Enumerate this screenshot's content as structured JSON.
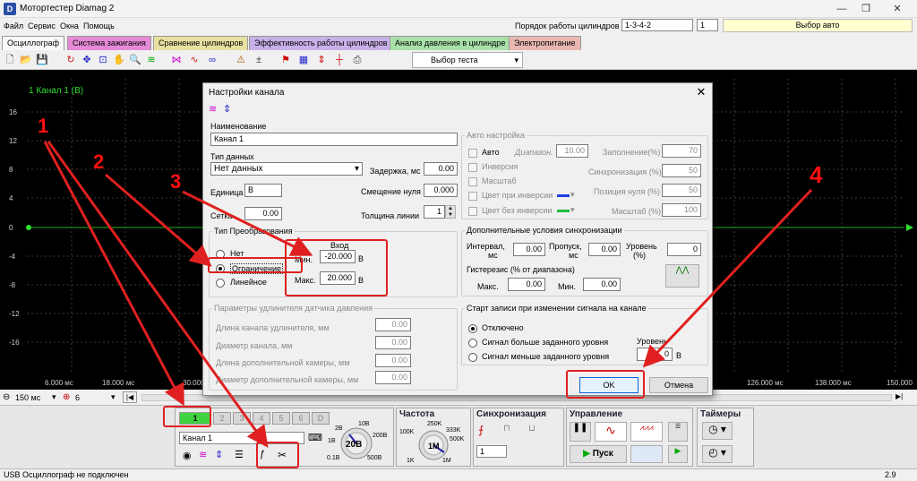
{
  "window": {
    "title": "Мотортестер Diamag 2",
    "icon_text": "D"
  },
  "menu": [
    "Файл",
    "Сервис",
    "Окна",
    "Помощь"
  ],
  "cylinder_order": {
    "label": "Порядок работы цилиндров",
    "value": "1-3-4-2",
    "count": "1",
    "auto_button": "Выбор авто"
  },
  "tabs": [
    {
      "label": "Осциллограф",
      "color": "#f0f0f0"
    },
    {
      "label": "Система зажигания",
      "color": "#e58ad6"
    },
    {
      "label": "Сравнение цилиндров",
      "color": "#e8e0a0"
    },
    {
      "label": "Эффективность работы цилиндров",
      "color": "#c8b0e8"
    },
    {
      "label": "Анализ давления в цилиндре",
      "color": "#a8e0a8"
    },
    {
      "label": "Электропитание",
      "color": "#e8b8b0"
    }
  ],
  "toolbar": {
    "test_select": "Выбор теста"
  },
  "scope": {
    "channel_label": "1 Канал 1 (B)",
    "y_ticks": [
      "16",
      "12",
      "8",
      "4",
      "0",
      "-4",
      "-8",
      "-12",
      "-16"
    ],
    "x_ticks": [
      "6.000 мс",
      "18.000 мс",
      "30.000",
      "126.000 мс",
      "138.000 мс",
      "150.000"
    ],
    "timebase": "150 мс",
    "trigger": "6"
  },
  "dialog": {
    "title": "Настройки канала",
    "name_label": "Наименование",
    "name_value": "Канал 1",
    "data_type_label": "Тип данных",
    "data_type_value": "Нет данных",
    "delay_label": "Задержка, мс",
    "delay_value": "0.00",
    "unit_label": "Единица",
    "unit_value": "В",
    "zero_shift_label": "Смещение нуля",
    "zero_shift_value": "0.000",
    "grid_label": "Сетка",
    "grid_value": "0.00",
    "line_width_label": "Толщина линии",
    "line_width_value": "1",
    "transform": {
      "title": "Тип Преобразования",
      "options": [
        "Нет",
        "Ограничение",
        "Линейное"
      ],
      "selected": "Ограничение",
      "input_header": "Вход",
      "min_label": "Мин.",
      "min_value": "-20.000",
      "max_label": "Макс.",
      "max_value": "20.000",
      "unit": "В"
    },
    "extender": {
      "title": "Параметры удлинителя датчика давления",
      "rows": [
        {
          "label": "Длина канала удлинителя, мм",
          "value": "0.00"
        },
        {
          "label": "Диаметр канала, мм",
          "value": "0.00"
        },
        {
          "label": "Длина дополнительной камеры, мм",
          "value": "0.00"
        },
        {
          "label": "Диаметр дополнительной камеры, мм",
          "value": "0.00"
        }
      ]
    },
    "auto": {
      "title": "Авто настройка",
      "checks": [
        "Авто",
        "Инверсия",
        "Масштаб",
        "Цвет при инверсии",
        "Цвет без инверсии"
      ],
      "range_label": "Диапазон.",
      "range_value": "10.00",
      "fill_label": "Заполнение(%)",
      "fill_value": "70",
      "sync_label": "Синхронизация (%)",
      "sync_value": "50",
      "zero_pos_label": "Позиция нуля (%)",
      "zero_pos_value": "50",
      "scale_label": "Масштаб (%)",
      "scale_value": "100",
      "inv_color": "#2040e0",
      "noinv_color": "#20c040"
    },
    "sync": {
      "title": "Дополнительные условия синхронизации",
      "interval_label": "Интервал,",
      "interval_unit": "мс",
      "interval_value": "0.00",
      "skip_label": "Пропуск,",
      "skip_unit": "мс",
      "skip_value": "0.00",
      "level_label": "Уровень",
      "level_unit": "(%)",
      "level_value": "0",
      "hyst_label": "Гистерезис (% от диапазона)",
      "max_label": "Макс.",
      "max_value": "0.00",
      "min_label": "Мин.",
      "min_value": "0.00"
    },
    "record": {
      "title": "Старт записи при изменении сигнала на канале",
      "options": [
        "Отключено",
        "Сигнал больше заданного уровня",
        "Сигнал меньше заданного уровня"
      ],
      "selected": "Отключено",
      "level_label": "Уровень",
      "level_value": "0",
      "unit": "В"
    },
    "ok": "OK",
    "cancel": "Отмена"
  },
  "bottom": {
    "channels": [
      "1",
      "2",
      "3",
      "4",
      "5",
      "6",
      "D"
    ],
    "channel_name": "Канал 1",
    "volt_ticks": [
      "2B",
      "10B",
      "200B",
      "500B",
      "0.1B",
      "1B"
    ],
    "volt_value": "20B",
    "freq_title": "Частота",
    "freq_ticks": [
      "250K",
      "333K",
      "500K",
      "100K",
      "1K",
      "1M"
    ],
    "freq_value": "1M",
    "sync_title": "Синхронизация",
    "sync_value": "1",
    "control_title": "Управление",
    "start": "Пуск",
    "timers_title": "Таймеры"
  },
  "status": {
    "text": "USB Осциллограф не подключен",
    "version": "2.9"
  },
  "annotations": [
    "1",
    "2",
    "3",
    "4"
  ]
}
